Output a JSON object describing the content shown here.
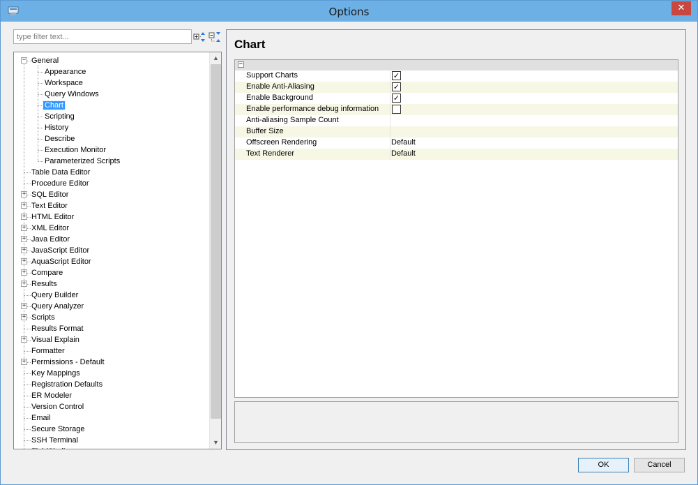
{
  "window": {
    "title": "Options"
  },
  "filter": {
    "placeholder": "type filter text..."
  },
  "tree": {
    "items": [
      {
        "label": "General",
        "level": 0,
        "expandable": true,
        "expanded": true
      },
      {
        "label": "Appearance",
        "level": 1
      },
      {
        "label": "Workspace",
        "level": 1
      },
      {
        "label": "Query Windows",
        "level": 1
      },
      {
        "label": "Chart",
        "level": 1,
        "selected": true
      },
      {
        "label": "Scripting",
        "level": 1
      },
      {
        "label": "History",
        "level": 1
      },
      {
        "label": "Describe",
        "level": 1
      },
      {
        "label": "Execution Monitor",
        "level": 1
      },
      {
        "label": "Parameterized Scripts",
        "level": 1
      },
      {
        "label": "Table Data Editor",
        "level": 0
      },
      {
        "label": "Procedure Editor",
        "level": 0
      },
      {
        "label": "SQL Editor",
        "level": 0,
        "expandable": true
      },
      {
        "label": "Text Editor",
        "level": 0,
        "expandable": true
      },
      {
        "label": "HTML Editor",
        "level": 0,
        "expandable": true
      },
      {
        "label": "XML Editor",
        "level": 0,
        "expandable": true
      },
      {
        "label": "Java Editor",
        "level": 0,
        "expandable": true
      },
      {
        "label": "JavaScript Editor",
        "level": 0,
        "expandable": true
      },
      {
        "label": "AquaScript Editor",
        "level": 0,
        "expandable": true
      },
      {
        "label": "Compare",
        "level": 0,
        "expandable": true
      },
      {
        "label": "Results",
        "level": 0,
        "expandable": true
      },
      {
        "label": "Query Builder",
        "level": 0
      },
      {
        "label": "Query Analyzer",
        "level": 0,
        "expandable": true
      },
      {
        "label": "Scripts",
        "level": 0,
        "expandable": true
      },
      {
        "label": "Results Format",
        "level": 0
      },
      {
        "label": "Visual Explain",
        "level": 0,
        "expandable": true
      },
      {
        "label": "Formatter",
        "level": 0
      },
      {
        "label": "Permissions - Default",
        "level": 0,
        "expandable": true
      },
      {
        "label": "Key Mappings",
        "level": 0
      },
      {
        "label": "Registration Defaults",
        "level": 0
      },
      {
        "label": "ER Modeler",
        "level": 0
      },
      {
        "label": "Version Control",
        "level": 0
      },
      {
        "label": "Email",
        "level": 0
      },
      {
        "label": "Secure Storage",
        "level": 0
      },
      {
        "label": "SSH Terminal",
        "level": 0
      },
      {
        "label": "FluidShell",
        "level": 0
      }
    ]
  },
  "page": {
    "title": "Chart"
  },
  "properties": [
    {
      "name": "Support Charts",
      "type": "checkbox",
      "checked": true
    },
    {
      "name": "Enable Anti-Aliasing",
      "type": "checkbox",
      "checked": true
    },
    {
      "name": "Enable Background",
      "type": "checkbox",
      "checked": true
    },
    {
      "name": "Enable performance debug information",
      "type": "checkbox",
      "checked": false
    },
    {
      "name": "Anti-aliasing Sample Count",
      "type": "text",
      "value": ""
    },
    {
      "name": "Buffer Size",
      "type": "text",
      "value": ""
    },
    {
      "name": "Offscreen Rendering",
      "type": "text",
      "value": "Default"
    },
    {
      "name": "Text Renderer",
      "type": "text",
      "value": "Default"
    }
  ],
  "buttons": {
    "ok": "OK",
    "cancel": "Cancel"
  },
  "colors": {
    "titlebar": "#6cb0e6",
    "selection": "#3399ff",
    "alt_row": "#f7f7e6",
    "close": "#c9473e"
  }
}
